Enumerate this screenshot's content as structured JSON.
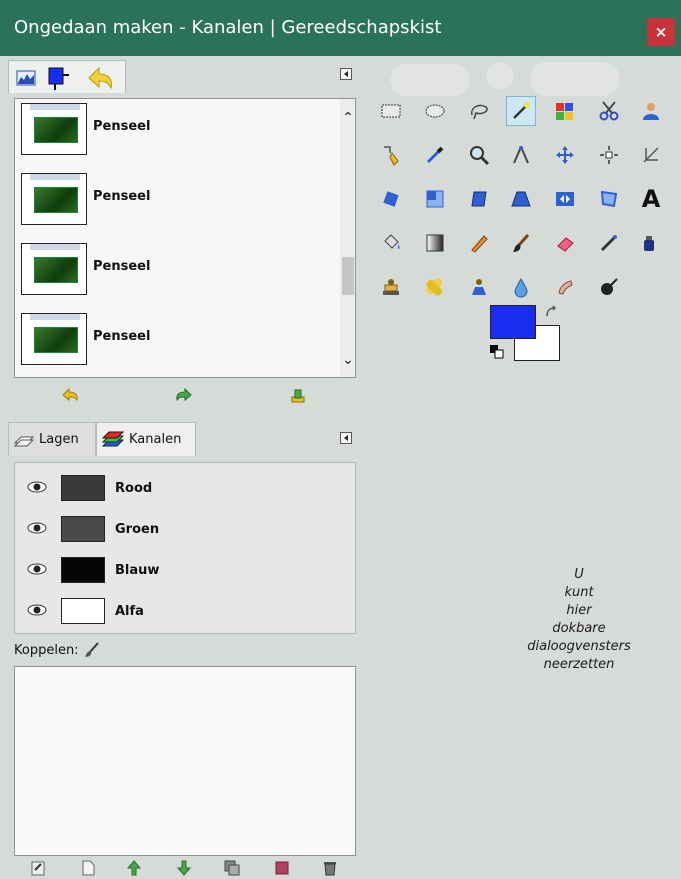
{
  "window": {
    "title": "Ongedaan maken - Kanalen | Gereedschapskist",
    "close_glyph": "×",
    "title_bg": "#2a7358",
    "close_bg": "#c8323a"
  },
  "undo_panel": {
    "tab_icons": [
      "histogram-icon",
      "fg-bg-color-icon",
      "undo-history-icon"
    ],
    "items": [
      {
        "label": "Penseel"
      },
      {
        "label": "Penseel"
      },
      {
        "label": "Penseel"
      },
      {
        "label": "Penseel"
      }
    ],
    "actions": [
      "undo-icon",
      "redo-icon",
      "clear-history-icon"
    ]
  },
  "channels_panel": {
    "tabs": [
      {
        "label": "Lagen",
        "icon": "layers-icon",
        "active": false
      },
      {
        "label": "Kanalen",
        "icon": "channels-icon",
        "active": true
      }
    ],
    "channels": [
      {
        "label": "Rood",
        "thumb": "#3a3a3a"
      },
      {
        "label": "Groen",
        "thumb": "#4a4a4a"
      },
      {
        "label": "Blauw",
        "thumb": "#050505"
      },
      {
        "label": "Alfa",
        "thumb": "#ffffff"
      }
    ],
    "link_label": "Koppelen:",
    "actions": [
      "edit-channel-icon",
      "new-channel-icon",
      "raise-channel-icon",
      "lower-channel-icon",
      "duplicate-channel-icon",
      "channel-to-selection-icon",
      "delete-channel-icon"
    ]
  },
  "toolbox": {
    "tools": [
      "rect-select-icon",
      "ellipse-select-icon",
      "free-select-icon",
      "fuzzy-select-icon",
      "select-by-color-icon",
      "scissors-select-icon",
      "foreground-select-icon",
      "paths-icon",
      "color-picker-icon",
      "zoom-icon",
      "measure-icon",
      "move-icon",
      "align-icon",
      "crop-icon",
      "rotate-icon",
      "scale-icon",
      "shear-icon",
      "perspective-icon",
      "flip-icon",
      "cage-icon",
      "text-icon",
      "bucket-fill-icon",
      "blend-icon",
      "pencil-icon",
      "paintbrush-icon",
      "eraser-icon",
      "airbrush-icon",
      "ink-icon",
      "clone-icon",
      "heal-icon",
      "perspective-clone-icon",
      "blur-icon",
      "smudge-icon",
      "dodge-burn-icon"
    ],
    "selected_tool": "fuzzy-select-icon",
    "fg_color": "#1a2cf0",
    "bg_color": "#ffffff",
    "text_tool_glyph": "A"
  },
  "dock_message": [
    "U",
    "kunt",
    "hier",
    "dokbare",
    "dialoogvensters",
    "neerzetten"
  ]
}
